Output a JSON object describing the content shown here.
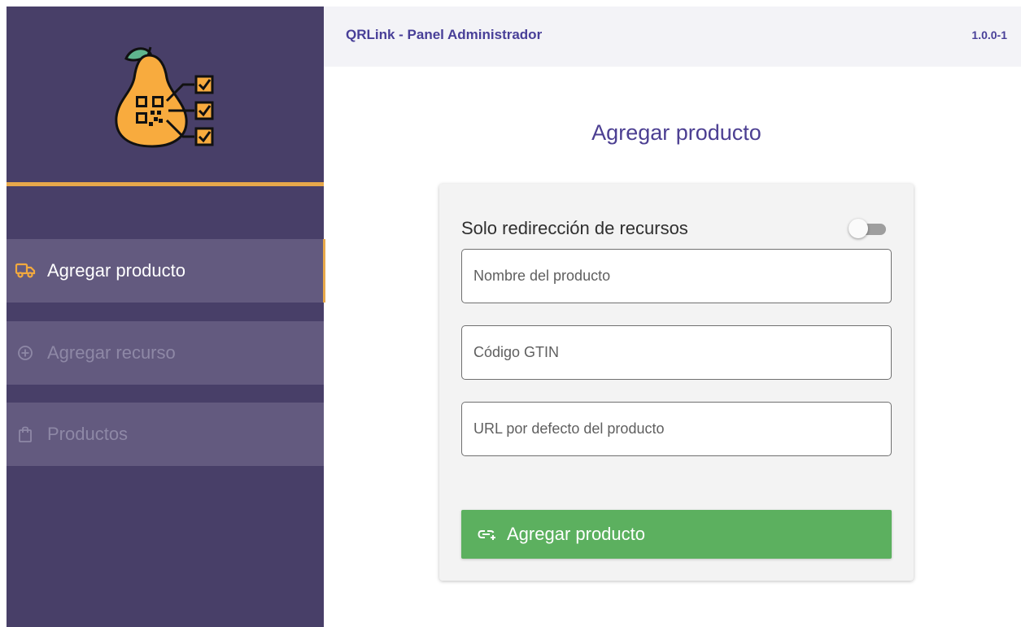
{
  "header": {
    "app_title": "QRLink - Panel Administrador",
    "version": "1.0.0-1"
  },
  "sidebar": {
    "logo_icon": "pear-qr-checklist-logo",
    "items": [
      {
        "label": "Agregar producto",
        "icon": "truck-icon",
        "active": true
      },
      {
        "label": "Agregar recurso",
        "icon": "plus-circle-icon",
        "active": false
      },
      {
        "label": "Productos",
        "icon": "shopping-bag-icon",
        "active": false
      }
    ]
  },
  "main": {
    "title": "Agregar producto",
    "form": {
      "toggle_label": "Solo redirección de recursos",
      "toggle_on": false,
      "fields": [
        {
          "placeholder": "Nombre del producto",
          "value": ""
        },
        {
          "placeholder": "Código GTIN",
          "value": ""
        },
        {
          "placeholder": "URL por defecto del producto",
          "value": ""
        }
      ],
      "submit_label": "Agregar producto",
      "submit_icon": "link-add-icon"
    }
  },
  "colors": {
    "sidebar_bg": "#483f68",
    "accent": "#e7a84a",
    "title": "#4c3f92",
    "submit": "#5cb05f"
  }
}
